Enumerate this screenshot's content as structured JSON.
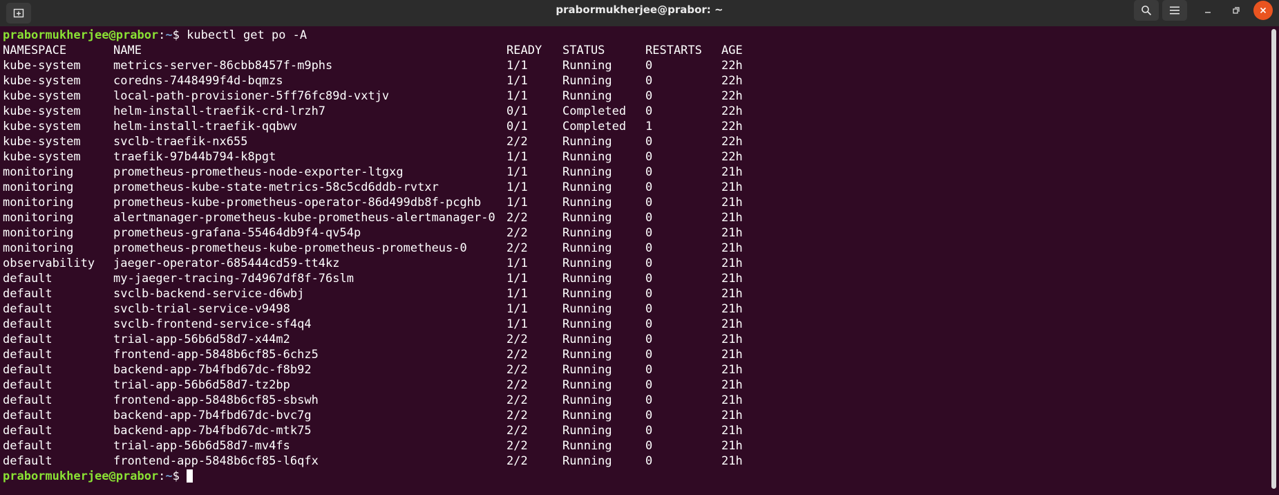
{
  "window": {
    "title": "prabormukherjee@prabor: ~"
  },
  "prompt": {
    "user_host": "prabormukherjee@prabor",
    "colon": ":",
    "path": "~",
    "dollar": "$ ",
    "command": "kubectl get po -A"
  },
  "table": {
    "headers": [
      "NAMESPACE",
      "NAME",
      "READY",
      "STATUS",
      "RESTARTS",
      "AGE"
    ],
    "rows": [
      [
        "kube-system",
        "metrics-server-86cbb8457f-m9phs",
        "1/1",
        "Running",
        "0",
        "22h"
      ],
      [
        "kube-system",
        "coredns-7448499f4d-bqmzs",
        "1/1",
        "Running",
        "0",
        "22h"
      ],
      [
        "kube-system",
        "local-path-provisioner-5ff76fc89d-vxtjv",
        "1/1",
        "Running",
        "0",
        "22h"
      ],
      [
        "kube-system",
        "helm-install-traefik-crd-lrzh7",
        "0/1",
        "Completed",
        "0",
        "22h"
      ],
      [
        "kube-system",
        "helm-install-traefik-qqbwv",
        "0/1",
        "Completed",
        "1",
        "22h"
      ],
      [
        "kube-system",
        "svclb-traefik-nx655",
        "2/2",
        "Running",
        "0",
        "22h"
      ],
      [
        "kube-system",
        "traefik-97b44b794-k8pgt",
        "1/1",
        "Running",
        "0",
        "22h"
      ],
      [
        "monitoring",
        "prometheus-prometheus-node-exporter-ltgxg",
        "1/1",
        "Running",
        "0",
        "21h"
      ],
      [
        "monitoring",
        "prometheus-kube-state-metrics-58c5cd6ddb-rvtxr",
        "1/1",
        "Running",
        "0",
        "21h"
      ],
      [
        "monitoring",
        "prometheus-kube-prometheus-operator-86d499db8f-pcghb",
        "1/1",
        "Running",
        "0",
        "21h"
      ],
      [
        "monitoring",
        "alertmanager-prometheus-kube-prometheus-alertmanager-0",
        "2/2",
        "Running",
        "0",
        "21h"
      ],
      [
        "monitoring",
        "prometheus-grafana-55464db9f4-qv54p",
        "2/2",
        "Running",
        "0",
        "21h"
      ],
      [
        "monitoring",
        "prometheus-prometheus-kube-prometheus-prometheus-0",
        "2/2",
        "Running",
        "0",
        "21h"
      ],
      [
        "observability",
        "jaeger-operator-685444cd59-tt4kz",
        "1/1",
        "Running",
        "0",
        "21h"
      ],
      [
        "default",
        "my-jaeger-tracing-7d4967df8f-76slm",
        "1/1",
        "Running",
        "0",
        "21h"
      ],
      [
        "default",
        "svclb-backend-service-d6wbj",
        "1/1",
        "Running",
        "0",
        "21h"
      ],
      [
        "default",
        "svclb-trial-service-v9498",
        "1/1",
        "Running",
        "0",
        "21h"
      ],
      [
        "default",
        "svclb-frontend-service-sf4q4",
        "1/1",
        "Running",
        "0",
        "21h"
      ],
      [
        "default",
        "trial-app-56b6d58d7-x44m2",
        "2/2",
        "Running",
        "0",
        "21h"
      ],
      [
        "default",
        "frontend-app-5848b6cf85-6chz5",
        "2/2",
        "Running",
        "0",
        "21h"
      ],
      [
        "default",
        "backend-app-7b4fbd67dc-f8b92",
        "2/2",
        "Running",
        "0",
        "21h"
      ],
      [
        "default",
        "trial-app-56b6d58d7-tz2bp",
        "2/2",
        "Running",
        "0",
        "21h"
      ],
      [
        "default",
        "frontend-app-5848b6cf85-sbswh",
        "2/2",
        "Running",
        "0",
        "21h"
      ],
      [
        "default",
        "backend-app-7b4fbd67dc-bvc7g",
        "2/2",
        "Running",
        "0",
        "21h"
      ],
      [
        "default",
        "backend-app-7b4fbd67dc-mtk75",
        "2/2",
        "Running",
        "0",
        "21h"
      ],
      [
        "default",
        "trial-app-56b6d58d7-mv4fs",
        "2/2",
        "Running",
        "0",
        "21h"
      ],
      [
        "default",
        "frontend-app-5848b6cf85-l6qfx",
        "2/2",
        "Running",
        "0",
        "21h"
      ]
    ]
  },
  "icons": {
    "new_tab": "new-tab-icon",
    "search": "search-icon",
    "menu": "hamburger-menu-icon",
    "minimize": "minimize-icon",
    "maximize": "maximize-icon",
    "close": "close-icon"
  },
  "colors": {
    "background": "#300a24",
    "titlebar": "#2c2c2c",
    "prompt_user": "#8ae234",
    "prompt_path": "#729fcf",
    "close_button": "#e95420"
  }
}
